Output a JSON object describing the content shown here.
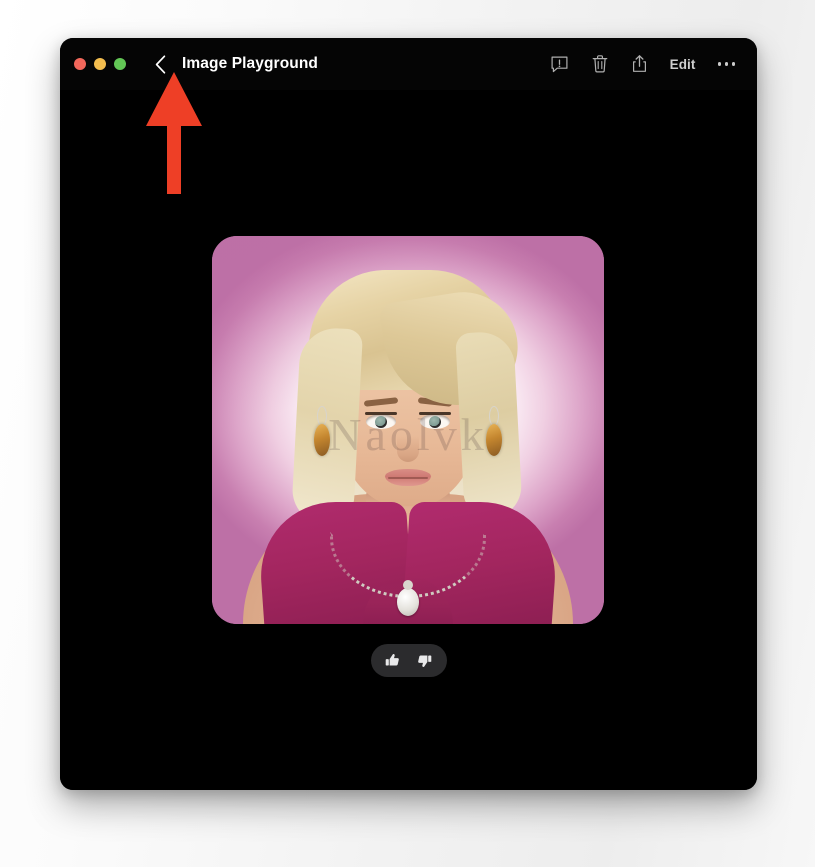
{
  "page": {
    "background_color": "#f2f2f2"
  },
  "window": {
    "background_color": "#000000",
    "traffic_lights": [
      {
        "name": "close",
        "color": "#f2675b"
      },
      {
        "name": "minimize",
        "color": "#f3bd4e"
      },
      {
        "name": "maximize",
        "color": "#62c655"
      }
    ],
    "back_button": {
      "icon": "chevron-left-icon",
      "label": "Back"
    },
    "title": "Image Playground",
    "toolbar": [
      {
        "name": "report-concern",
        "icon": "speech-bubble-exclamation-icon",
        "label": "Report a Concern"
      },
      {
        "name": "delete",
        "icon": "trash-icon",
        "label": "Delete"
      },
      {
        "name": "share",
        "icon": "share-icon",
        "label": "Share"
      },
      {
        "name": "edit",
        "icon": "text-label",
        "label": "Edit"
      },
      {
        "name": "more",
        "icon": "ellipsis-icon",
        "label": "More"
      }
    ]
  },
  "main": {
    "generated_image": {
      "name": "generated-portrait",
      "alt": "Illustrated portrait of a blonde woman in a magenta dress with silver necklace and amber earrings on a pink radial gradient background",
      "watermark_text": "Naolvk",
      "background_accent": "#bd70a6",
      "dress_color": "#a3265f",
      "hair_color": "#e6d3a5",
      "skin_color": "#ecc3a3"
    },
    "feedback": {
      "background_color": "#2b2b2d",
      "buttons": [
        {
          "name": "thumbs-up",
          "icon": "thumbs-up-icon",
          "label": "Good result"
        },
        {
          "name": "thumbs-down",
          "icon": "thumbs-down-icon",
          "label": "Bad result"
        }
      ]
    }
  },
  "annotation": {
    "arrow": {
      "name": "red-pointer-arrow",
      "color": "#ee3f26",
      "direction": "up",
      "points_to": "back-button"
    }
  }
}
